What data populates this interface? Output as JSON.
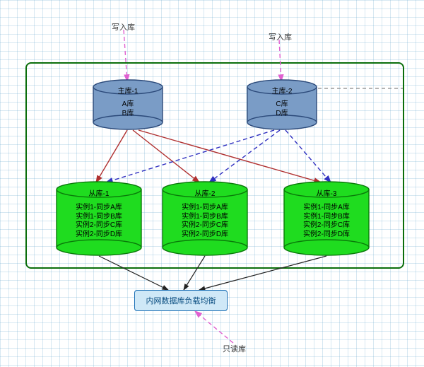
{
  "labels": {
    "write1": "写入库",
    "write2": "写入库",
    "read": "只读库"
  },
  "container": {
    "title": ""
  },
  "masters": [
    {
      "title": "主库-1",
      "lines": [
        "A库",
        "B库"
      ]
    },
    {
      "title": "主库-2",
      "lines": [
        "C库",
        "D库"
      ]
    }
  ],
  "slaves": [
    {
      "title": "从库-1",
      "lines": [
        "实例1-同步A库",
        "实例1-同步B库",
        "实例2-同步C库",
        "实例2-同步D库"
      ]
    },
    {
      "title": "从库-2",
      "lines": [
        "实例1-同步A库",
        "实例1-同步B库",
        "实例2-同步C库",
        "实例2-同步D库"
      ]
    },
    {
      "title": "从库-3",
      "lines": [
        "实例1-同步A库",
        "实例1-同步B库",
        "实例2-同步C库",
        "实例2-同步D库"
      ]
    }
  ],
  "lb": {
    "label": "内网数据库负载均衡"
  },
  "colors": {
    "master_fill": "#7a9cc6",
    "master_stroke": "#2c4a7a",
    "slave_fill": "#1fdc1f",
    "slave_stroke": "#0a7a0a",
    "lb_fill": "#cfe8f7",
    "lb_stroke": "#1a6fb5",
    "link_master1": "#b03030",
    "link_master2": "#3030c0",
    "link_pink": "#e060d0",
    "link_gray": "#888888",
    "link_black": "#222222",
    "outer_border": "#0b6e0b"
  },
  "chart_data": {
    "type": "diagram",
    "title": "Database replication & load-balancing topology",
    "nodes": [
      {
        "id": "write1",
        "type": "label",
        "text": "写入库"
      },
      {
        "id": "write2",
        "type": "label",
        "text": "写入库"
      },
      {
        "id": "master1",
        "type": "master-db",
        "title": "主库-1",
        "schemas": [
          "A库",
          "B库"
        ]
      },
      {
        "id": "master2",
        "type": "master-db",
        "title": "主库-2",
        "schemas": [
          "C库",
          "D库"
        ]
      },
      {
        "id": "slave1",
        "type": "slave-db",
        "title": "从库-1",
        "instances": [
          "实例1-同步A库",
          "实例1-同步B库",
          "实例2-同步C库",
          "实例2-同步D库"
        ]
      },
      {
        "id": "slave2",
        "type": "slave-db",
        "title": "从库-2",
        "instances": [
          "实例1-同步A库",
          "实例1-同步B库",
          "实例2-同步C库",
          "实例2-同步D库"
        ]
      },
      {
        "id": "slave3",
        "type": "slave-db",
        "title": "从库-3",
        "instances": [
          "实例1-同步A库",
          "实例1-同步B库",
          "实例2-同步C库",
          "实例2-同步D库"
        ]
      },
      {
        "id": "lb",
        "type": "load-balancer",
        "label": "内网数据库负载均衡"
      },
      {
        "id": "read",
        "type": "label",
        "text": "只读库"
      }
    ],
    "edges": [
      {
        "from": "write1",
        "to": "master1",
        "style": "dashed",
        "color": "#e060d0"
      },
      {
        "from": "write2",
        "to": "master2",
        "style": "dashed",
        "color": "#e060d0"
      },
      {
        "from": "master2",
        "to": "external",
        "style": "dashed",
        "color": "#888888"
      },
      {
        "from": "master1",
        "to": "slave1",
        "style": "solid",
        "color": "#b03030"
      },
      {
        "from": "master1",
        "to": "slave2",
        "style": "solid",
        "color": "#b03030"
      },
      {
        "from": "master1",
        "to": "slave3",
        "style": "solid",
        "color": "#b03030"
      },
      {
        "from": "master2",
        "to": "slave1",
        "style": "dashed",
        "color": "#3030c0"
      },
      {
        "from": "master2",
        "to": "slave2",
        "style": "dashed",
        "color": "#3030c0"
      },
      {
        "from": "master2",
        "to": "slave3",
        "style": "dashed",
        "color": "#3030c0"
      },
      {
        "from": "slave1",
        "to": "lb",
        "style": "solid",
        "color": "#222222"
      },
      {
        "from": "slave2",
        "to": "lb",
        "style": "solid",
        "color": "#222222"
      },
      {
        "from": "slave3",
        "to": "lb",
        "style": "solid",
        "color": "#222222"
      },
      {
        "from": "read",
        "to": "lb",
        "style": "dashed",
        "color": "#e060d0"
      }
    ]
  }
}
